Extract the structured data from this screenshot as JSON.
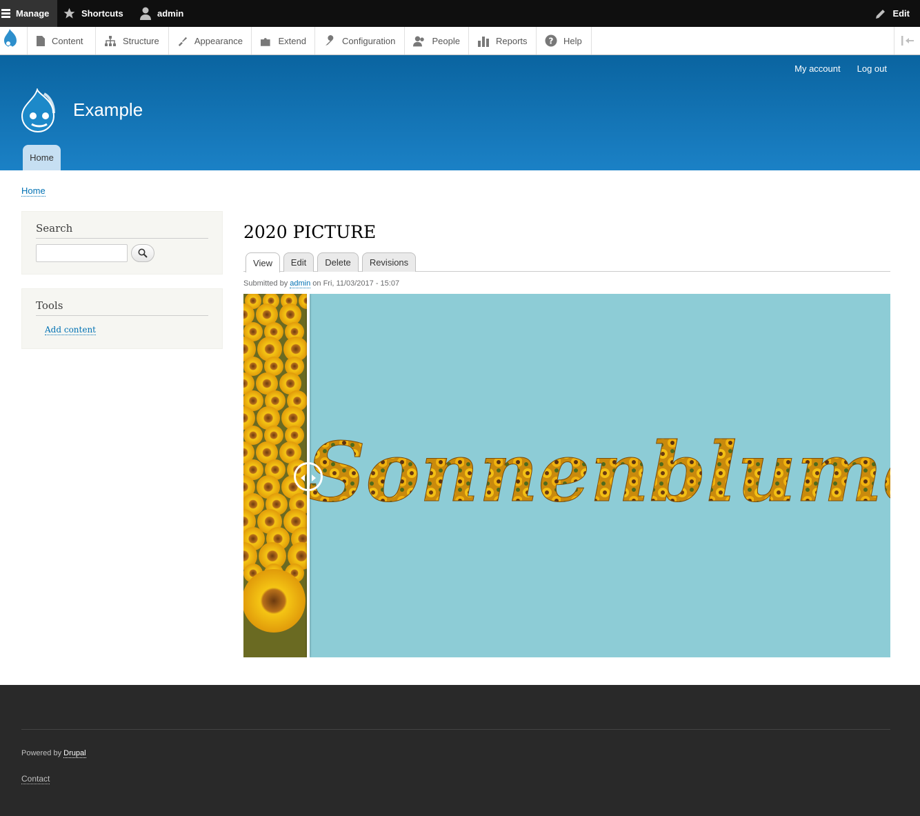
{
  "toolbar": {
    "manage": "Manage",
    "shortcuts": "Shortcuts",
    "user": "admin",
    "edit": "Edit"
  },
  "tray": {
    "items": [
      {
        "label": "Content",
        "icon": "file-icon"
      },
      {
        "label": "Structure",
        "icon": "sitemap-icon"
      },
      {
        "label": "Appearance",
        "icon": "paintbrush-icon"
      },
      {
        "label": "Extend",
        "icon": "puzzle-icon"
      },
      {
        "label": "Configuration",
        "icon": "wrench-icon"
      },
      {
        "label": "People",
        "icon": "people-icon"
      },
      {
        "label": "Reports",
        "icon": "bar-chart-icon"
      },
      {
        "label": "Help",
        "icon": "question-icon"
      }
    ]
  },
  "header": {
    "secondary": [
      "My account",
      "Log out"
    ],
    "site_name": "Example",
    "home_tab": "Home",
    "colors": {
      "top": "#0a64a0",
      "bottom": "#1b81c6"
    }
  },
  "breadcrumb": "Home",
  "sidebar": {
    "search_title": "Search",
    "search_placeholder": "",
    "tools_title": "Tools",
    "tools_link": "Add content"
  },
  "main": {
    "title": "2020 PICTURE",
    "tabs": [
      "View",
      "Edit",
      "Delete",
      "Revisions"
    ],
    "active_tab": "View",
    "submitted_prefix": "Submitted by",
    "submitted_user": "admin",
    "submitted_suffix": "on Fri, 11/03/2017 - 15:07",
    "image_text": "Sonnenblumen",
    "image_bg": "#8dccd6"
  },
  "footer": {
    "powered_prefix": "Powered by",
    "powered_link": "Drupal",
    "contact": "Contact"
  }
}
